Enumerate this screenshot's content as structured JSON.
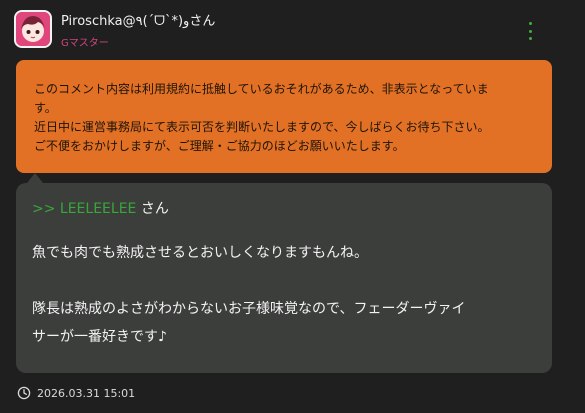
{
  "comment": {
    "username": "Piroschka@٩(ˊᗜˋ*)وさん",
    "rank": "Gマスター",
    "accent_color": "#e0467c",
    "menu_icon": "kebab-menu-icon",
    "warning": {
      "lines": [
        "このコメント内容は利用規約に抵触しているおそれがあるため、非表示となっていま",
        "す。",
        "近日中に運営事務局にて表示可否を判断いたしますので、今しばらくお待ち下さい。",
        "ご不便をおかけしますが、ご理解・ご協力のほどお願いいたします。"
      ],
      "background": "#e27125"
    },
    "reply": {
      "mention": ">> LEELEELEE",
      "mention_suffix": "さん",
      "paragraphs": [
        [
          "魚でも肉でも熟成させるとおいしくなりますもんね。"
        ],
        [
          "隊長は熟成のよさがわからないお子様味覚なので、フェーダーヴァイ",
          "サーが一番好きです♪"
        ]
      ],
      "mention_color": "#3aa53a"
    },
    "timestamp": "2026.03.31 15:01",
    "timestamp_icon": "clock-icon"
  }
}
